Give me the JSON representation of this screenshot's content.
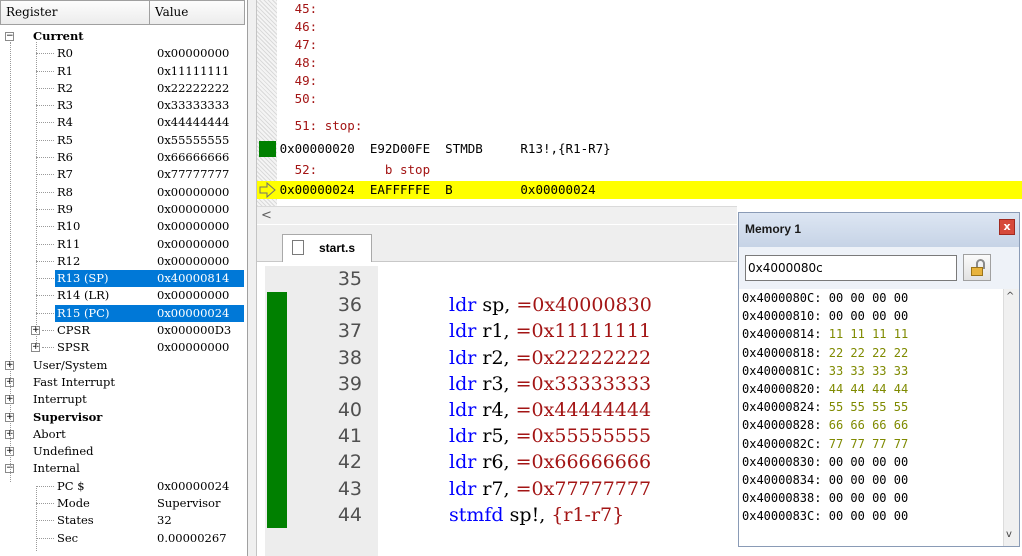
{
  "registers": {
    "col_register": "Register",
    "col_value": "Value",
    "rows": [
      {
        "name": "Current",
        "value": "",
        "bold": true,
        "depth": 0,
        "box": "⊟"
      },
      {
        "name": "R0",
        "value": "0x00000000",
        "depth": 1
      },
      {
        "name": "R1",
        "value": "0x11111111",
        "depth": 1
      },
      {
        "name": "R2",
        "value": "0x22222222",
        "depth": 1
      },
      {
        "name": "R3",
        "value": "0x33333333",
        "depth": 1
      },
      {
        "name": "R4",
        "value": "0x44444444",
        "depth": 1
      },
      {
        "name": "R5",
        "value": "0x55555555",
        "depth": 1
      },
      {
        "name": "R6",
        "value": "0x66666666",
        "depth": 1
      },
      {
        "name": "R7",
        "value": "0x77777777",
        "depth": 1
      },
      {
        "name": "R8",
        "value": "0x00000000",
        "depth": 1
      },
      {
        "name": "R9",
        "value": "0x00000000",
        "depth": 1
      },
      {
        "name": "R10",
        "value": "0x00000000",
        "depth": 1
      },
      {
        "name": "R11",
        "value": "0x00000000",
        "depth": 1
      },
      {
        "name": "R12",
        "value": "0x00000000",
        "depth": 1
      },
      {
        "name": "R13 (SP)",
        "value": "0x40000814",
        "depth": 1,
        "selected": true
      },
      {
        "name": "R14 (LR)",
        "value": "0x00000000",
        "depth": 1
      },
      {
        "name": "R15 (PC)",
        "value": "0x00000024",
        "depth": 1,
        "selected": true
      },
      {
        "name": "CPSR",
        "value": "0x000000D3",
        "depth": 1,
        "box": "⊞"
      },
      {
        "name": "SPSR",
        "value": "0x00000000",
        "depth": 1,
        "box": "⊞"
      },
      {
        "name": "User/System",
        "value": "",
        "depth": 0,
        "box": "⊞"
      },
      {
        "name": "Fast Interrupt",
        "value": "",
        "depth": 0,
        "box": "⊞"
      },
      {
        "name": "Interrupt",
        "value": "",
        "depth": 0,
        "box": "⊞"
      },
      {
        "name": "Supervisor",
        "value": "",
        "bold": true,
        "depth": 0,
        "box": "⊞"
      },
      {
        "name": "Abort",
        "value": "",
        "depth": 0,
        "box": "⊞"
      },
      {
        "name": "Undefined",
        "value": "",
        "depth": 0,
        "box": "⊞"
      },
      {
        "name": "Internal",
        "value": "",
        "depth": 0,
        "box": "⊟"
      },
      {
        "name": "PC  $",
        "value": "0x00000024",
        "depth": 1
      },
      {
        "name": "Mode",
        "value": "Supervisor",
        "depth": 1
      },
      {
        "name": "States",
        "value": "32",
        "depth": 1
      },
      {
        "name": "Sec",
        "value": "0.00000267",
        "depth": 1
      }
    ]
  },
  "disassembly": {
    "lines": [
      {
        "text": "     45:",
        "kind": "src"
      },
      {
        "text": "     46:",
        "kind": "src"
      },
      {
        "text": "     47:",
        "kind": "src"
      },
      {
        "text": "     48:",
        "kind": "src"
      },
      {
        "text": "     49:",
        "kind": "src"
      },
      {
        "text": "     50:",
        "kind": "src"
      },
      {
        "text": "     51: stop:",
        "kind": "src"
      },
      {
        "text": "   0x00000020  E92D00FE  STMDB     R13!,{R1-R7}",
        "kind": "asm",
        "marker": "green"
      },
      {
        "text": "     52:         b stop",
        "kind": "src"
      },
      {
        "text": "   0x00000024  EAFFFFFE  B         0x00000024",
        "kind": "asm",
        "current": true,
        "marker": "arrow"
      }
    ],
    "scroll_left": "<"
  },
  "editor": {
    "tab_label": "start.s",
    "lines": [
      {
        "num": "35",
        "mnemonic": "",
        "operand": "",
        "value": "",
        "marker": false
      },
      {
        "num": "36",
        "mnemonic": "ldr",
        "operand": "sp,",
        "value": "=0x40000830",
        "marker": true
      },
      {
        "num": "37",
        "mnemonic": "ldr",
        "operand": "r1,",
        "value": "=0x11111111",
        "marker": true
      },
      {
        "num": "38",
        "mnemonic": "ldr",
        "operand": "r2,",
        "value": "=0x22222222",
        "marker": true
      },
      {
        "num": "39",
        "mnemonic": "ldr",
        "operand": "r3,",
        "value": "=0x33333333",
        "marker": true
      },
      {
        "num": "40",
        "mnemonic": "ldr",
        "operand": "r4,",
        "value": "=0x44444444",
        "marker": true
      },
      {
        "num": "41",
        "mnemonic": "ldr",
        "operand": "r5,",
        "value": "=0x55555555",
        "marker": true
      },
      {
        "num": "42",
        "mnemonic": "ldr",
        "operand": "r6,",
        "value": "=0x66666666",
        "marker": true
      },
      {
        "num": "43",
        "mnemonic": "ldr",
        "operand": "r7,",
        "value": "=0x77777777",
        "marker": true
      },
      {
        "num": "44",
        "mnemonic": "stmfd",
        "operand": "sp!,",
        "value": "{r1-r7}",
        "marker": true
      }
    ]
  },
  "memory": {
    "title": "Memory 1",
    "close": "x",
    "address": "0x4000080c",
    "rows": [
      {
        "addr": "0x4000080C:",
        "bytes": "00 00 00 00",
        "changed": false
      },
      {
        "addr": "0x40000810:",
        "bytes": "00 00 00 00",
        "changed": false
      },
      {
        "addr": "0x40000814:",
        "bytes": "11 11 11 11",
        "changed": true
      },
      {
        "addr": "0x40000818:",
        "bytes": "22 22 22 22",
        "changed": true
      },
      {
        "addr": "0x4000081C:",
        "bytes": "33 33 33 33",
        "changed": true
      },
      {
        "addr": "0x40000820:",
        "bytes": "44 44 44 44",
        "changed": true
      },
      {
        "addr": "0x40000824:",
        "bytes": "55 55 55 55",
        "changed": true
      },
      {
        "addr": "0x40000828:",
        "bytes": "66 66 66 66",
        "changed": true
      },
      {
        "addr": "0x4000082C:",
        "bytes": "77 77 77 77",
        "changed": true
      },
      {
        "addr": "0x40000830:",
        "bytes": "00 00 00 00",
        "changed": false
      },
      {
        "addr": "0x40000834:",
        "bytes": "00 00 00 00",
        "changed": false
      },
      {
        "addr": "0x40000838:",
        "bytes": "00 00 00 00",
        "changed": false
      },
      {
        "addr": "0x4000083C:",
        "bytes": "00 00 00 00",
        "changed": false
      }
    ],
    "scroll_up": "^",
    "scroll_down": "v"
  },
  "colors": {
    "selection": "#0078d7",
    "current_line": "#ffff00",
    "breakpoint_marker": "#008000",
    "source_text": "#a31515",
    "keyword": "#0000ff",
    "changed_bytes": "#7f8a00"
  }
}
